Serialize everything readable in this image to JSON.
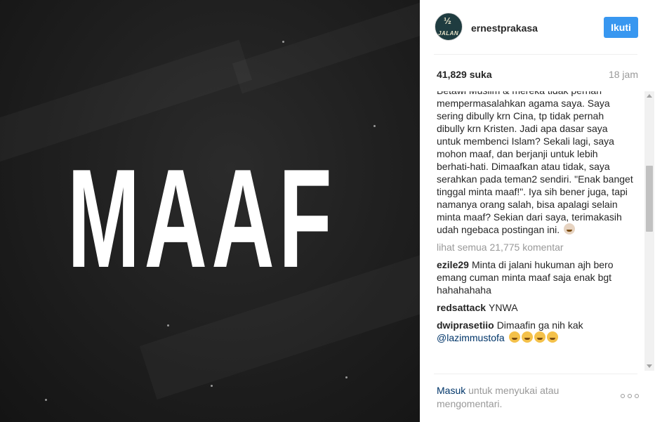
{
  "post": {
    "image_text": "MAAF"
  },
  "header": {
    "avatar_text_top": "½",
    "avatar_text_bottom": "JALAN",
    "username": "ernestprakasa",
    "follow_label": "Ikuti"
  },
  "stats": {
    "likes": "41,829 suka",
    "time": "18 jam"
  },
  "caption": "Betawi Muslim & mereka tidak pernah mempermasalahkan agama saya. Saya sering dibully krn Cina, tp tidak pernah dibully krn Kristen. Jadi apa dasar saya untuk membenci Islam? Sekali lagi, saya mohon maaf, dan berjanji untuk lebih berhati-hati. Dimaafkan atau tidak, saya serahkan pada teman2 sendiri. \"Enak banget tinggal minta maaf!\". Iya sih bener juga, tapi namanya orang salah, bisa apalagi selain minta maaf? Sekian dari saya, terimakasih udah ngebaca postingan ini.",
  "view_all_comments": "lihat semua 21,775 komentar",
  "comments": [
    {
      "author": "ezile29",
      "text": "Minta di jalani hukuman ajh bero emang cuman minta maaf saja enak bgt hahahahaha"
    },
    {
      "author": "redsattack",
      "text": "YNWA"
    },
    {
      "author": "dwiprasetiio",
      "text": "Dimaafin ga nih kak",
      "mention": "@lazimmustofa"
    }
  ],
  "footer": {
    "login_link": "Masuk",
    "login_rest": "untuk menyukai atau mengomentari."
  }
}
